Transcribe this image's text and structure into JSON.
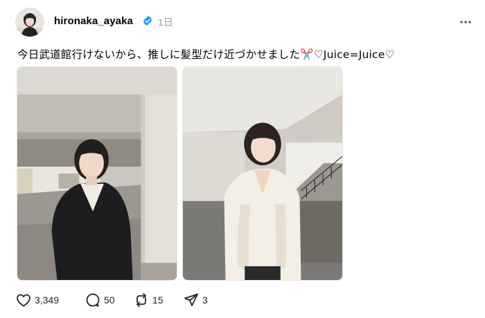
{
  "post": {
    "username": "hironaka_ayaka",
    "time": "1日",
    "caption": "今日武道館行けないから、推しに髪型だけ近づかせました✂️♡Juice=Juice♡",
    "avatar_icon": "profile-avatar",
    "verified_icon": "verified-badge-icon",
    "more_icon": "more-options-icon"
  },
  "media": [
    {
      "name": "photo-1",
      "description": "photo"
    },
    {
      "name": "photo-2",
      "description": "photo"
    }
  ],
  "actions": {
    "likes": "3,349",
    "comments": "50",
    "reposts": "15",
    "shares": "3"
  },
  "colors": {
    "verified": "#1d9bf0",
    "muted": "#999999",
    "text": "#000000"
  }
}
